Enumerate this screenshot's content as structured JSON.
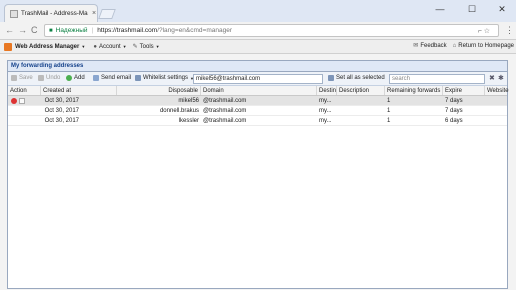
{
  "browser": {
    "tab_title": "TrashMail - Address-Ma",
    "tab_close": "×",
    "window_buttons": [
      "—",
      "☐",
      "✕"
    ],
    "nav": {
      "back": "←",
      "forward": "→",
      "reload": "C"
    },
    "address": {
      "secure_label": "Надежный",
      "separator": "|",
      "host": "https://trashmail.com",
      "path": "/?lang=en&cmd=manager",
      "right_icons": "⌐ ☆"
    },
    "menu_icon": "⋮"
  },
  "appbar": {
    "product": "Web Address Manager",
    "account": "Account",
    "tools": "Tools",
    "feedback": "Feedback",
    "return_home": "Return to Homepage"
  },
  "panel": {
    "title": "My forwarding addresses",
    "toolbar": {
      "save": "Save",
      "undo": "Undo",
      "add": "Add",
      "send_email": "Send email",
      "whitelist": "Whitelist settings",
      "email_value": "mikel56@trashmail.com",
      "set_all": "Set all as selected",
      "search_placeholder": "search"
    },
    "columns": [
      "Action",
      "Created at",
      "Disposable",
      "Domain",
      "Destina",
      "Description",
      "Remaining forwards",
      "Expire",
      "Website"
    ],
    "rows": [
      {
        "created": "Oct 30, 2017",
        "disposable": "mikel56",
        "domain": "@trashmail.com",
        "dest": "my...",
        "remaining": "1",
        "expire": "7 days"
      },
      {
        "created": "Oct 30, 2017",
        "disposable": "donnell.brakus",
        "domain": "@trashmail.com",
        "dest": "my...",
        "remaining": "1",
        "expire": "7 days"
      },
      {
        "created": "Oct 30, 2017",
        "disposable": "lkessler",
        "domain": "@trashmail.com",
        "dest": "my...",
        "remaining": "1",
        "expire": "6 days"
      }
    ]
  },
  "colors": {
    "accent": "#15428b",
    "panel_header": "#dfe8f6",
    "selected_row": "#e3e3e3"
  }
}
